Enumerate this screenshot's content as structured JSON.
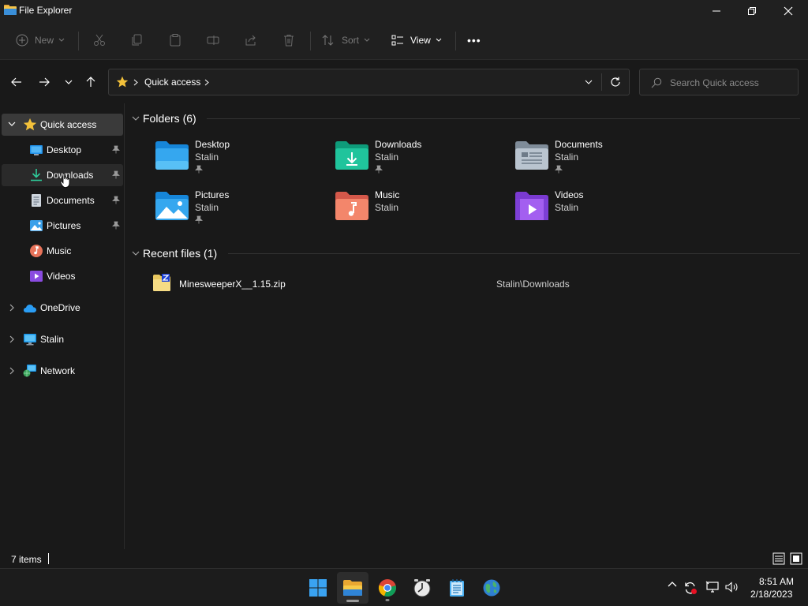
{
  "window": {
    "title": "File Explorer",
    "controls": [
      "minimize",
      "restore",
      "close"
    ]
  },
  "toolbar": {
    "new_label": "New",
    "sort_label": "Sort",
    "view_label": "View",
    "more_label": "•••"
  },
  "address": {
    "crumb": "Quick access",
    "search_placeholder": "Search Quick access"
  },
  "nav": {
    "quick_access": "Quick access",
    "items": [
      {
        "label": "Desktop",
        "icon": "desktop-icon",
        "pinned": true
      },
      {
        "label": "Downloads",
        "icon": "downloads-icon",
        "pinned": true
      },
      {
        "label": "Documents",
        "icon": "documents-icon",
        "pinned": true
      },
      {
        "label": "Pictures",
        "icon": "pictures-icon",
        "pinned": true
      },
      {
        "label": "Music",
        "icon": "music-icon",
        "pinned": false
      },
      {
        "label": "Videos",
        "icon": "videos-icon",
        "pinned": false
      }
    ],
    "roots": [
      {
        "label": "OneDrive",
        "icon": "onedrive-icon"
      },
      {
        "label": "Stalin",
        "icon": "pc-icon"
      },
      {
        "label": "Network",
        "icon": "network-icon"
      }
    ]
  },
  "content": {
    "folders_header": "Folders (6)",
    "folders": [
      {
        "name": "Desktop",
        "owner": "Stalin",
        "pinned": true
      },
      {
        "name": "Downloads",
        "owner": "Stalin",
        "pinned": true
      },
      {
        "name": "Documents",
        "owner": "Stalin",
        "pinned": true
      },
      {
        "name": "Pictures",
        "owner": "Stalin",
        "pinned": true
      },
      {
        "name": "Music",
        "owner": "Stalin",
        "pinned": false
      },
      {
        "name": "Videos",
        "owner": "Stalin",
        "pinned": false
      }
    ],
    "recent_header": "Recent files (1)",
    "recent": [
      {
        "name": "MinesweeperX__1.15.zip",
        "location": "Stalin\\Downloads"
      }
    ]
  },
  "status": {
    "count": "7 items"
  },
  "taskbar": {
    "apps": [
      "start",
      "file-explorer",
      "chrome",
      "clock-app",
      "notepad",
      "globe-app"
    ],
    "time": "8:51 AM",
    "date": "2/18/2023"
  },
  "colors": {
    "background": "#191919",
    "chrome": "#202020",
    "selected": "#3a3a3a",
    "accent": "#0078d4"
  }
}
